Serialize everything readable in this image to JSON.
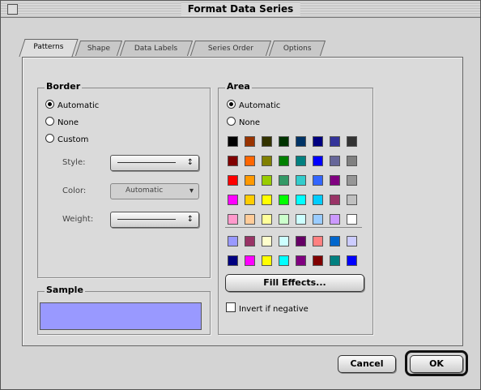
{
  "window": {
    "title": "Format Data Series"
  },
  "tabs": [
    {
      "label": "Patterns",
      "active": true
    },
    {
      "label": "Shape",
      "active": false
    },
    {
      "label": "Data Labels",
      "active": false
    },
    {
      "label": "Series Order",
      "active": false
    },
    {
      "label": "Options",
      "active": false
    }
  ],
  "border": {
    "label": "Border",
    "options": [
      {
        "label": "Automatic",
        "checked": true
      },
      {
        "label": "None",
        "checked": false
      },
      {
        "label": "Custom",
        "checked": false
      }
    ],
    "style_label": "Style:",
    "color_label": "Color:",
    "color_value": "Automatic",
    "weight_label": "Weight:"
  },
  "sample": {
    "label": "Sample",
    "color": "#9999ff"
  },
  "area": {
    "label": "Area",
    "options": [
      {
        "label": "Automatic",
        "checked": true
      },
      {
        "label": "None",
        "checked": false
      }
    ],
    "palette_main": [
      [
        "#000000",
        "#993300",
        "#333300",
        "#003300",
        "#003366",
        "#000080",
        "#333399",
        "#333333"
      ],
      [
        "#800000",
        "#ff6600",
        "#808000",
        "#008000",
        "#008080",
        "#0000ff",
        "#666699",
        "#808080"
      ],
      [
        "#ff0000",
        "#ff9900",
        "#99cc00",
        "#339966",
        "#33cccc",
        "#3366ff",
        "#800080",
        "#969696"
      ],
      [
        "#ff00ff",
        "#ffcc00",
        "#ffff00",
        "#00ff00",
        "#00ffff",
        "#00ccff",
        "#993366",
        "#c0c0c0"
      ],
      [
        "#ff99cc",
        "#ffcc99",
        "#ffff99",
        "#ccffcc",
        "#ccffff",
        "#99ccff",
        "#cc99ff",
        "#ffffff"
      ]
    ],
    "palette_chart": [
      [
        "#9999ff",
        "#993366",
        "#ffffcc",
        "#ccffff",
        "#660066",
        "#ff8080",
        "#0066cc",
        "#ccccff"
      ],
      [
        "#000080",
        "#ff00ff",
        "#ffff00",
        "#00ffff",
        "#800080",
        "#800000",
        "#008080",
        "#0000ff"
      ]
    ],
    "fill_effects_label": "Fill Effects...",
    "invert_label": "Invert if negative"
  },
  "buttons": {
    "cancel": "Cancel",
    "ok": "OK"
  }
}
